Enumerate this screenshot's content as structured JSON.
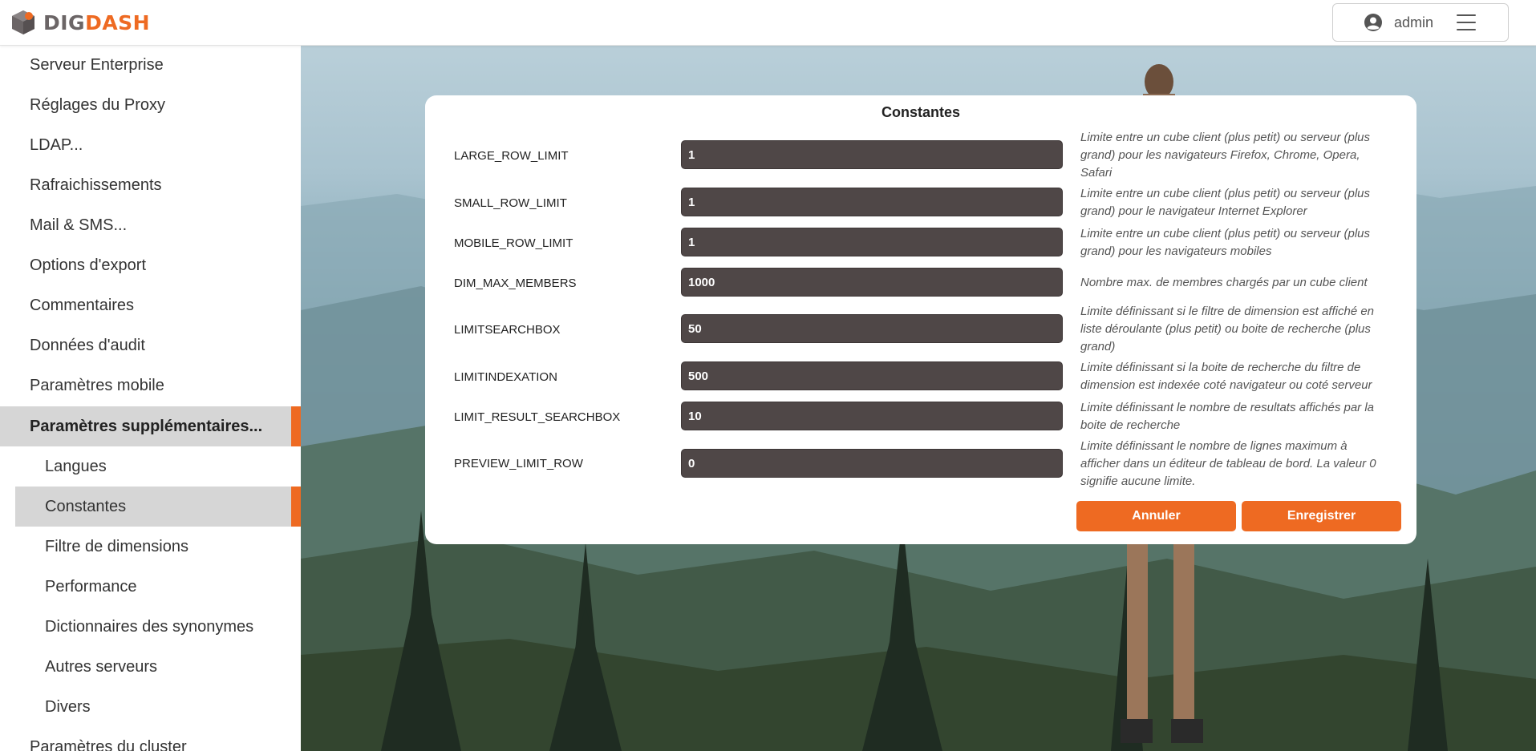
{
  "header": {
    "logo_dig": "DIG",
    "logo_dash": "DASH",
    "username": "admin"
  },
  "sidebar": {
    "items": [
      {
        "label": "Serveur Enterprise"
      },
      {
        "label": "Réglages du Proxy"
      },
      {
        "label": "LDAP..."
      },
      {
        "label": "Rafraichissements"
      },
      {
        "label": "Mail & SMS..."
      },
      {
        "label": "Options d'export"
      },
      {
        "label": "Commentaires"
      },
      {
        "label": "Données d'audit"
      },
      {
        "label": "Paramètres mobile"
      },
      {
        "label": "Paramètres supplémentaires..."
      },
      {
        "label": "Langues"
      },
      {
        "label": "Constantes"
      },
      {
        "label": "Filtre de dimensions"
      },
      {
        "label": "Performance"
      },
      {
        "label": "Dictionnaires des synonymes"
      },
      {
        "label": "Autres serveurs"
      },
      {
        "label": "Divers"
      },
      {
        "label": "Paramètres du cluster"
      }
    ]
  },
  "dialog": {
    "title": "Constantes",
    "rows": [
      {
        "label": "LARGE_ROW_LIMIT",
        "value": "1",
        "desc_lines": [
          "Limite entre un cube client (plus petit) ou serveur (plus",
          "grand) pour les navigateurs Firefox, Chrome, Opera,",
          "Safari"
        ]
      },
      {
        "label": "SMALL_ROW_LIMIT",
        "value": "1",
        "desc_lines": [
          "Limite entre un cube client (plus petit) ou serveur (plus",
          "grand) pour le navigateur Internet Explorer"
        ]
      },
      {
        "label": "MOBILE_ROW_LIMIT",
        "value": "1",
        "desc_lines": [
          "Limite entre un cube client (plus petit) ou serveur (plus",
          "grand) pour les navigateurs mobiles"
        ]
      },
      {
        "label": "DIM_MAX_MEMBERS",
        "value": "1000",
        "desc_lines": [
          "Nombre max. de membres chargés par un cube client"
        ]
      },
      {
        "label": "LIMITSEARCHBOX",
        "value": "50",
        "desc_lines": [
          "Limite définissant si le filtre de dimension est affiché en",
          "liste déroulante (plus petit) ou boite de recherche (plus",
          "grand)"
        ]
      },
      {
        "label": "LIMITINDEXATION",
        "value": "500",
        "desc_lines": [
          "Limite définissant si la boite de recherche du filtre de",
          "dimension est indexée coté navigateur ou coté serveur"
        ]
      },
      {
        "label": "LIMIT_RESULT_SEARCHBOX",
        "value": "10",
        "desc_lines": [
          "Limite définissant le nombre de resultats affichés par la",
          "boite de recherche"
        ]
      },
      {
        "label": "PREVIEW_LIMIT_ROW",
        "value": "0",
        "desc_lines": [
          "Limite définissant le nombre de lignes maximum à",
          "afficher dans un éditeur de tableau de bord. La valeur 0",
          "signifie aucune limite."
        ]
      }
    ],
    "cancel_label": "Annuler",
    "save_label": "Enregistrer"
  },
  "colors": {
    "accent": "#ee6a22",
    "input_bg": "#4f4747",
    "selected_bg": "#d6d6d6"
  }
}
